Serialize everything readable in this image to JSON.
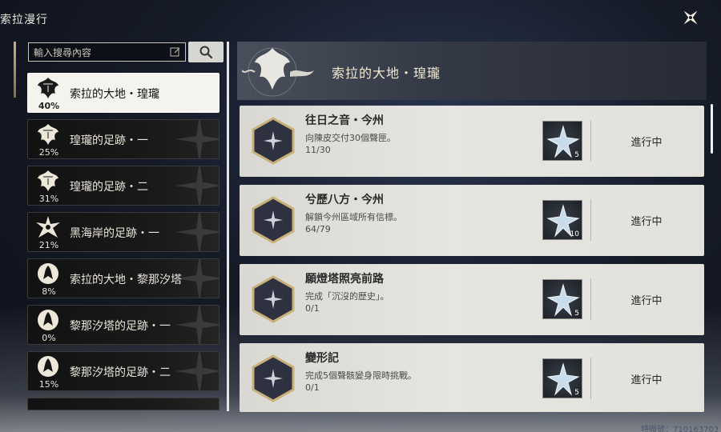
{
  "app": {
    "title": "索拉漫行"
  },
  "search": {
    "placeholder": "輸入搜尋內容"
  },
  "sidebar": {
    "items": [
      {
        "label": "索拉的大地・瑝瓏",
        "percent": "40%",
        "active": true,
        "icon": "dragon-crest-icon"
      },
      {
        "label": "瑝瓏的足跡・一",
        "percent": "25%",
        "active": false,
        "icon": "dragon-crest-icon"
      },
      {
        "label": "瑝瓏的足跡・二",
        "percent": "31%",
        "active": false,
        "icon": "dragon-crest-icon"
      },
      {
        "label": "黑海岸的足跡・一",
        "percent": "21%",
        "active": false,
        "icon": "star-crest-icon"
      },
      {
        "label": "索拉的大地・黎那汐塔",
        "percent": "8%",
        "active": false,
        "icon": "bird-crest-icon"
      },
      {
        "label": "黎那汐塔的足跡・一",
        "percent": "0%",
        "active": false,
        "icon": "bird-crest-icon"
      },
      {
        "label": "黎那汐塔的足跡・二",
        "percent": "15%",
        "active": false,
        "icon": "bird-crest-icon"
      }
    ]
  },
  "header": {
    "title": "索拉的大地・瑝瓏"
  },
  "quests": [
    {
      "title": "往日之音・今州",
      "desc": "向陳皮交付30個聲匣。",
      "progress": "11/30",
      "reward_count": "5",
      "status": "進行中"
    },
    {
      "title": "兮歷八方・今州",
      "desc": "解鎖今州區域所有信標。",
      "progress": "64/79",
      "reward_count": "10",
      "status": "進行中"
    },
    {
      "title": "願燈塔照亮前路",
      "desc": "完成「沉沒的歷史」。",
      "progress": "0/1",
      "reward_count": "5",
      "status": "進行中"
    },
    {
      "title": "變形記",
      "desc": "完成5個聲骸變身限時挑戰。",
      "progress": "0/1",
      "reward_count": "5",
      "status": "進行中"
    }
  ],
  "watermark": "特微號：710163703",
  "colors": {
    "accent_gold": "#c9b07a",
    "card_bg": "#e2e1dc",
    "active_item_bg": "#f4f3ee"
  }
}
